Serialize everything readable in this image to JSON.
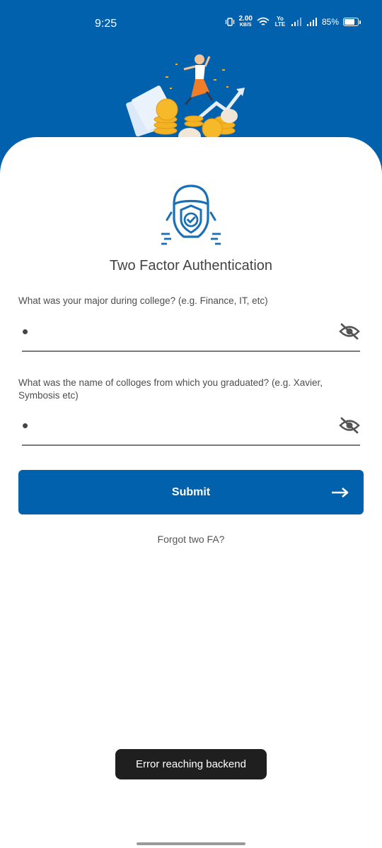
{
  "status_bar": {
    "time": "9:25",
    "net_speed": "2.00",
    "net_unit": "KB/S",
    "network_label": "Yo LTE",
    "battery": "85%",
    "battery_level": 0.85
  },
  "colors": {
    "brand_blue": "#0261ad",
    "toast_bg": "#1f1f1f"
  },
  "title": "Two Factor Authentication",
  "questions": [
    {
      "label": "What was your major during college? (e.g. Finance, IT, etc)",
      "value": "•"
    },
    {
      "label": "What was the name of colloges from which you graduated? (e.g. Xavier, Symbosis etc)",
      "value": "•"
    }
  ],
  "submit_label": "Submit",
  "forgot_label": "Forgot two FA?",
  "toast": "Error reaching backend"
}
